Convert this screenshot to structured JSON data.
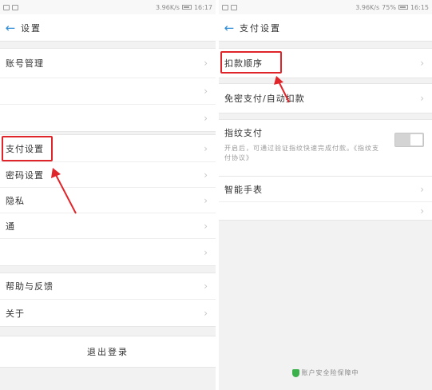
{
  "left": {
    "statusbar": {
      "info": "3.96K/s",
      "time": "16:17"
    },
    "title": "设置",
    "items": [
      {
        "label": "账号管理"
      },
      {
        "label": ""
      },
      {
        "label": "",
        "value": ""
      },
      {
        "label": "支付设置"
      },
      {
        "label": "密码设置"
      },
      {
        "label": "隐私"
      },
      {
        "label": "通"
      },
      {
        "label": ""
      },
      {
        "label": "帮助与反馈"
      },
      {
        "label": "关于"
      }
    ],
    "logout_label": "退出登录"
  },
  "right": {
    "statusbar": {
      "info": "3.96K/s",
      "battery": "75%",
      "time": "16:15"
    },
    "title": "支付设置",
    "items": [
      {
        "label": "扣款顺序"
      },
      {
        "label": "免密支付/自动扣款"
      },
      {
        "label": "指纹支付",
        "desc": "开启后，可通过验证指纹快速完成付款。",
        "desc2": "《指纹支付协议》"
      },
      {
        "label": "智能手表"
      },
      {
        "label": ""
      }
    ],
    "footer": "账户安全险保障中"
  },
  "colors": {
    "accent": "#2f8cd6",
    "highlight": "#e0252a",
    "shield": "#3cb04a"
  },
  "icons": [
    "back-arrow-icon",
    "chevron-right-icon",
    "shield-icon"
  ]
}
